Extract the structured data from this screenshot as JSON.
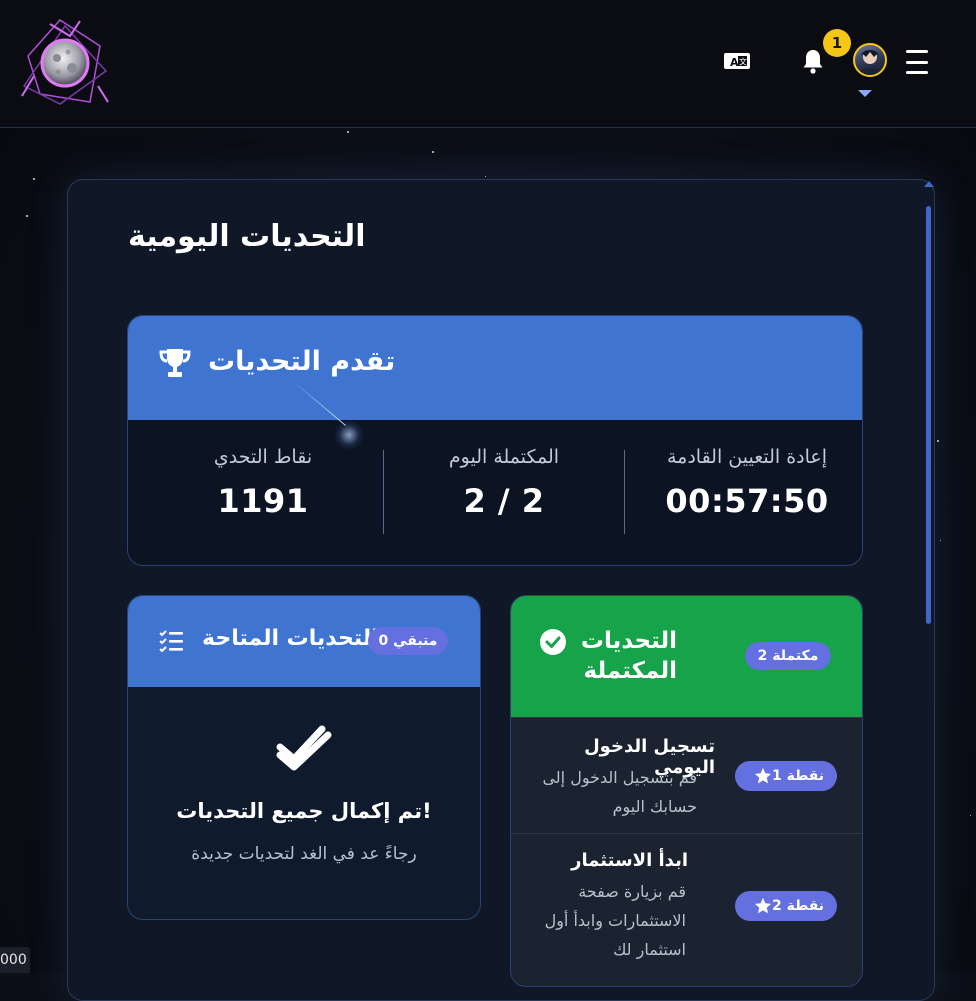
{
  "header": {
    "notification_count": "1",
    "icons": [
      "logo-moon",
      "translate-icon",
      "bell-icon",
      "avatar",
      "menu-icon"
    ]
  },
  "page": {
    "title": "التحديات اليومية"
  },
  "progress": {
    "title": "تقدم التحديات",
    "stats": [
      {
        "label": "إعادة التعيين القادمة",
        "value": "00:57:50"
      },
      {
        "label": "المكتملة اليوم",
        "value": "2 / 2"
      },
      {
        "label": "نقاط التحدي",
        "value": "1191"
      }
    ]
  },
  "available": {
    "title": "التحديات المتاحة",
    "remaining_badge": "متبقي 0",
    "done_title": "!تم إكمال جميع التحديات",
    "done_subtitle": "رجاءً عد في الغد لتحديات جديدة"
  },
  "completed": {
    "title": "التحديات المكتملة",
    "count_badge": "مكتملة 2",
    "items": [
      {
        "title": "تسجيل الدخول اليومي",
        "desc_lines": [
          "قم بتسجيل الدخول إلى",
          "حسابك اليوم"
        ],
        "points": "نقطة 1"
      },
      {
        "title": "ابدأ الاستثمار",
        "desc_lines": [
          "قم بزيارة صفحة",
          "الاستثمارات وابدأ أول",
          "استثمار لك"
        ],
        "points": "نقطة 2"
      }
    ]
  },
  "corner_text": "000",
  "colors": {
    "accent_blue": "#3f74d1",
    "success_green": "#16a34a",
    "badge_purple": "#6470e0",
    "notif_yellow": "#f5c518"
  }
}
